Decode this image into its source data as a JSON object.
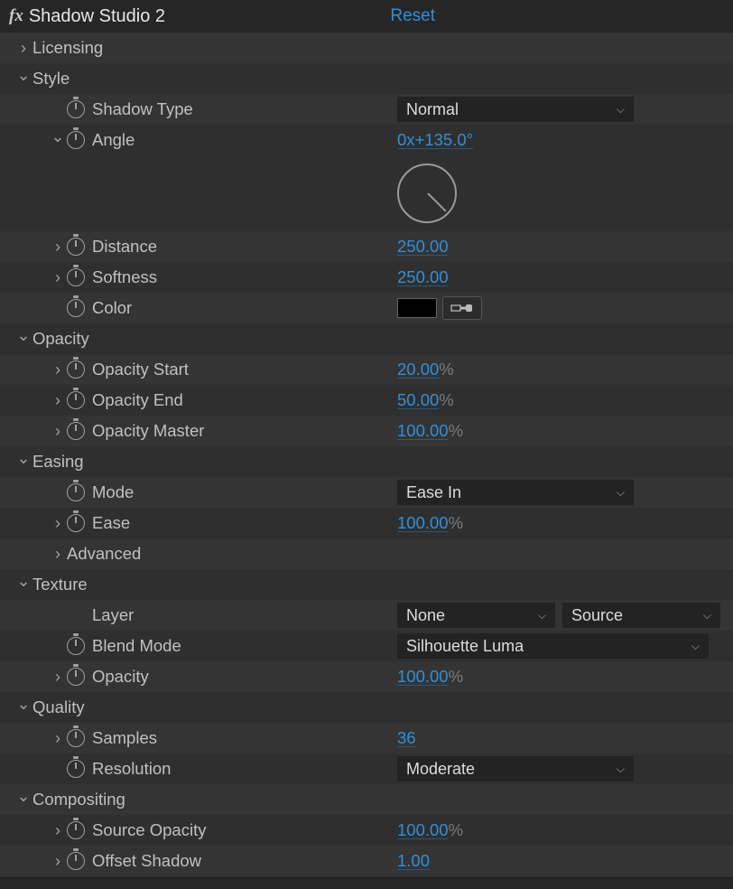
{
  "effect": {
    "title": "Shadow Studio 2",
    "reset": "Reset"
  },
  "groups": {
    "licensing": "Licensing",
    "style": "Style",
    "opacity": "Opacity",
    "easing": "Easing",
    "texture": "Texture",
    "quality": "Quality",
    "compositing": "Compositing",
    "advanced": "Advanced"
  },
  "style": {
    "shadow_type_label": "Shadow Type",
    "shadow_type_value": "Normal",
    "angle_label": "Angle",
    "angle_prefix": "0x",
    "angle_value": "+135.0°",
    "distance_label": "Distance",
    "distance_value": "250.00",
    "softness_label": "Softness",
    "softness_value": "250.00",
    "color_label": "Color"
  },
  "opacity": {
    "start_label": "Opacity Start",
    "start_value": "20.00",
    "end_label": "Opacity End",
    "end_value": "50.00",
    "master_label": "Opacity Master",
    "master_value": "100.00",
    "percent": "%"
  },
  "easing": {
    "mode_label": "Mode",
    "mode_value": "Ease In",
    "ease_label": "Ease",
    "ease_value": "100.00"
  },
  "texture": {
    "layer_label": "Layer",
    "layer_value": "None",
    "layer_src": "Source",
    "blend_label": "Blend Mode",
    "blend_value": "Silhouette Luma",
    "opacity_label": "Opacity",
    "opacity_value": "100.00"
  },
  "quality": {
    "samples_label": "Samples",
    "samples_value": "36",
    "resolution_label": "Resolution",
    "resolution_value": "Moderate"
  },
  "compositing": {
    "src_opacity_label": "Source Opacity",
    "src_opacity_value": "100.00",
    "offset_label": "Offset Shadow",
    "offset_value": "1.00"
  }
}
